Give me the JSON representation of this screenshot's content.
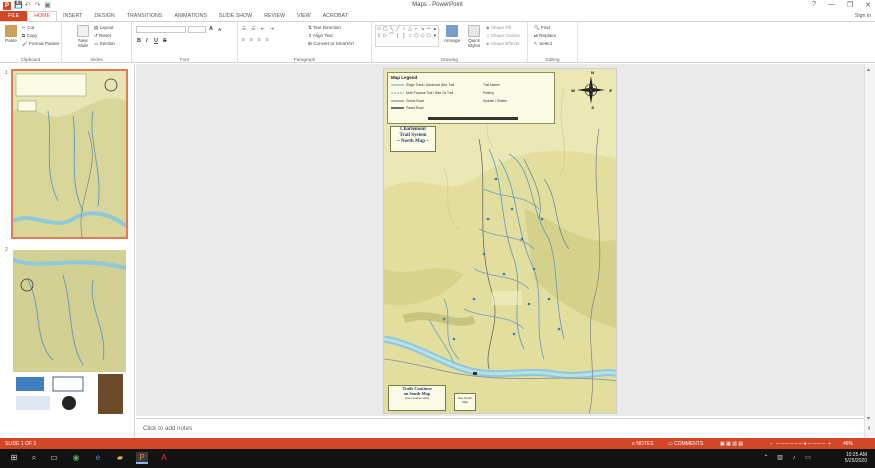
{
  "window": {
    "title": "Maps - PowerPoint",
    "minimize": "—",
    "restore": "❐",
    "close": "✕",
    "help": "?"
  },
  "qat": {
    "save": "💾",
    "undo": "↶",
    "redo": "↷",
    "present": "▣"
  },
  "tabs": [
    "FILE",
    "HOME",
    "INSERT",
    "DESIGN",
    "TRANSITIONS",
    "ANIMATIONS",
    "SLIDE SHOW",
    "REVIEW",
    "VIEW",
    "ACROBAT"
  ],
  "signin": "Sign in",
  "ribbon": {
    "clipboard": {
      "label": "Clipboard",
      "paste": "Paste",
      "cut": "Cut",
      "copy": "Copy",
      "format_painter": "Format Painter"
    },
    "slides": {
      "label": "Slides",
      "new_slide": "New Slide",
      "layout": "Layout",
      "reset": "Reset",
      "section": "Section"
    },
    "font": {
      "label": "Font",
      "bold": "B",
      "italic": "I",
      "underline": "U",
      "strike": "S",
      "grow": "A",
      "shrink": "A"
    },
    "paragraph": {
      "label": "Paragraph",
      "text_direction": "Text Direction",
      "align_text": "Align Text",
      "smartart": "Convert to SmartArt"
    },
    "drawing": {
      "label": "Drawing",
      "arrange": "Arrange",
      "quick_styles": "Quick Styles",
      "shape_fill": "Shape Fill",
      "shape_outline": "Shape Outline",
      "shape_effects": "Shape Effects"
    },
    "editing": {
      "label": "Editing",
      "find": "Find",
      "replace": "Replace",
      "select": "Select"
    }
  },
  "thumbnails": [
    {
      "number": "1",
      "selected": true
    },
    {
      "number": "2",
      "selected": false
    }
  ],
  "slide": {
    "legend_title": "Map Legend",
    "legend_rows": [
      "Single Track / Advanced Bike Trail",
      "Multi Purpose Trail / Bike Ok Trail",
      "Gravel Road",
      "Paved Road",
      "Trail Marker",
      "Parking",
      "Hydrant / Shelter"
    ],
    "map_title": [
      "Charlemont",
      "Trail System",
      "~ North Map ~"
    ],
    "trails_note": [
      "Trails Continue",
      "on South Map"
    ],
    "trails_note_sub": "(see reverse side)",
    "south_note": "See South Map",
    "compass_n": "N",
    "compass_s": "S",
    "compass_e": "E",
    "compass_w": "W"
  },
  "notes": {
    "placeholder": "Click to add notes"
  },
  "status": {
    "slide": "SLIDE 1 OF 2",
    "notes": "NOTES",
    "comments": "COMMENTS",
    "zoom": "46%"
  },
  "clock": {
    "time": "10:25 AM",
    "date": "5/25/2020"
  },
  "colors": {
    "accent": "#d24726",
    "map_bg": "#e6e3a8",
    "river": "#8fc8d8",
    "trail": "#6a9fc0"
  }
}
